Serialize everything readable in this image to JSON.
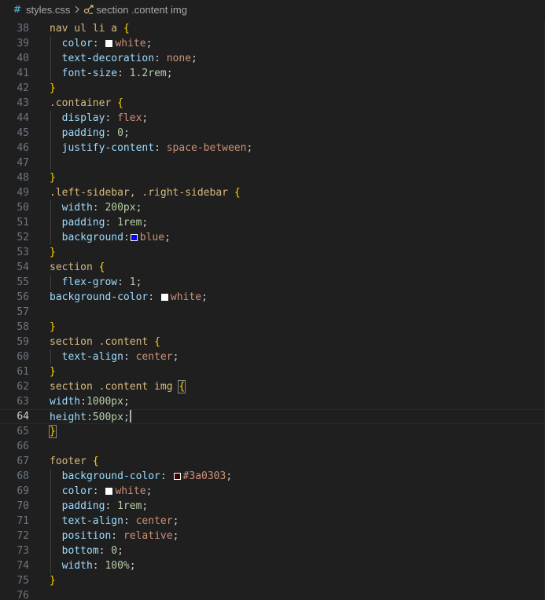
{
  "breadcrumb": {
    "file": "styles.css",
    "symbol": "section .content img"
  },
  "editor": {
    "lines": [
      {
        "n": "38",
        "tokens": [
          [
            "t-sel",
            "nav ul li a "
          ],
          [
            "t-brace",
            "{"
          ]
        ]
      },
      {
        "n": "39",
        "guide": true,
        "tokens": [
          [
            "t-punc",
            "  "
          ],
          [
            "t-prop",
            "color"
          ],
          [
            "t-punc",
            ": "
          ],
          [
            "swatch",
            "#ffffff"
          ],
          [
            "t-val",
            "white"
          ],
          [
            "t-punc",
            ";"
          ]
        ]
      },
      {
        "n": "40",
        "guide": true,
        "tokens": [
          [
            "t-punc",
            "  "
          ],
          [
            "t-prop",
            "text-decoration"
          ],
          [
            "t-punc",
            ": "
          ],
          [
            "t-val",
            "none"
          ],
          [
            "t-punc",
            ";"
          ]
        ]
      },
      {
        "n": "41",
        "guide": true,
        "tokens": [
          [
            "t-punc",
            "  "
          ],
          [
            "t-prop",
            "font-size"
          ],
          [
            "t-punc",
            ": "
          ],
          [
            "t-num",
            "1.2rem"
          ],
          [
            "t-punc",
            ";"
          ]
        ]
      },
      {
        "n": "42",
        "tokens": [
          [
            "t-brace",
            "}"
          ]
        ]
      },
      {
        "n": "43",
        "tokens": [
          [
            "t-sel",
            ".container "
          ],
          [
            "t-brace",
            "{"
          ]
        ]
      },
      {
        "n": "44",
        "guide": true,
        "tokens": [
          [
            "t-punc",
            "  "
          ],
          [
            "t-prop",
            "display"
          ],
          [
            "t-punc",
            ": "
          ],
          [
            "t-val",
            "flex"
          ],
          [
            "t-punc",
            ";"
          ]
        ]
      },
      {
        "n": "45",
        "guide": true,
        "tokens": [
          [
            "t-punc",
            "  "
          ],
          [
            "t-prop",
            "padding"
          ],
          [
            "t-punc",
            ": "
          ],
          [
            "t-num",
            "0"
          ],
          [
            "t-punc",
            ";"
          ]
        ]
      },
      {
        "n": "46",
        "guide": true,
        "tokens": [
          [
            "t-punc",
            "  "
          ],
          [
            "t-prop",
            "justify-content"
          ],
          [
            "t-punc",
            ": "
          ],
          [
            "t-val",
            "space-between"
          ],
          [
            "t-punc",
            ";"
          ]
        ]
      },
      {
        "n": "47",
        "guide": true,
        "tokens": []
      },
      {
        "n": "48",
        "tokens": [
          [
            "t-brace",
            "}"
          ]
        ]
      },
      {
        "n": "49",
        "tokens": [
          [
            "t-sel",
            ".left-sidebar, .right-sidebar "
          ],
          [
            "t-brace",
            "{"
          ]
        ]
      },
      {
        "n": "50",
        "guide": true,
        "tokens": [
          [
            "t-punc",
            "  "
          ],
          [
            "t-prop",
            "width"
          ],
          [
            "t-punc",
            ": "
          ],
          [
            "t-num",
            "200px"
          ],
          [
            "t-punc",
            ";"
          ]
        ]
      },
      {
        "n": "51",
        "guide": true,
        "tokens": [
          [
            "t-punc",
            "  "
          ],
          [
            "t-prop",
            "padding"
          ],
          [
            "t-punc",
            ": "
          ],
          [
            "t-num",
            "1rem"
          ],
          [
            "t-punc",
            ";"
          ]
        ]
      },
      {
        "n": "52",
        "guide": true,
        "tokens": [
          [
            "t-punc",
            "  "
          ],
          [
            "t-prop",
            "background"
          ],
          [
            "t-punc",
            ":"
          ],
          [
            "swatch",
            "#0000ff"
          ],
          [
            "t-val",
            "blue"
          ],
          [
            "t-punc",
            ";"
          ]
        ]
      },
      {
        "n": "53",
        "tokens": [
          [
            "t-brace",
            "}"
          ]
        ]
      },
      {
        "n": "54",
        "tokens": [
          [
            "t-sel",
            "section "
          ],
          [
            "t-brace",
            "{"
          ]
        ]
      },
      {
        "n": "55",
        "guide": true,
        "tokens": [
          [
            "t-punc",
            "  "
          ],
          [
            "t-prop",
            "flex-grow"
          ],
          [
            "t-punc",
            ": "
          ],
          [
            "t-num",
            "1"
          ],
          [
            "t-punc",
            ";"
          ]
        ]
      },
      {
        "n": "56",
        "tokens": [
          [
            "t-prop",
            "background-color"
          ],
          [
            "t-punc",
            ": "
          ],
          [
            "swatch",
            "#ffffff"
          ],
          [
            "t-val",
            "white"
          ],
          [
            "t-punc",
            ";"
          ]
        ]
      },
      {
        "n": "57",
        "tokens": []
      },
      {
        "n": "58",
        "tokens": [
          [
            "t-brace",
            "}"
          ]
        ]
      },
      {
        "n": "59",
        "tokens": [
          [
            "t-sel",
            "section .content "
          ],
          [
            "t-brace",
            "{"
          ]
        ]
      },
      {
        "n": "60",
        "guide": true,
        "tokens": [
          [
            "t-punc",
            "  "
          ],
          [
            "t-prop",
            "text-align"
          ],
          [
            "t-punc",
            ": "
          ],
          [
            "t-val",
            "center"
          ],
          [
            "t-punc",
            ";"
          ]
        ]
      },
      {
        "n": "61",
        "tokens": [
          [
            "t-brace",
            "}"
          ]
        ]
      },
      {
        "n": "62",
        "tokens": [
          [
            "t-sel",
            "section .content img "
          ],
          [
            "t-brace-match",
            "{"
          ]
        ]
      },
      {
        "n": "63",
        "tokens": [
          [
            "t-prop",
            "width"
          ],
          [
            "t-punc",
            ":"
          ],
          [
            "t-num",
            "1000px"
          ],
          [
            "t-punc",
            ";"
          ]
        ]
      },
      {
        "n": "64",
        "current": true,
        "cursor": true,
        "tokens": [
          [
            "t-prop",
            "height"
          ],
          [
            "t-punc",
            ":"
          ],
          [
            "t-num",
            "500px"
          ],
          [
            "t-punc",
            ";"
          ]
        ]
      },
      {
        "n": "65",
        "tokens": [
          [
            "t-brace-match",
            "}"
          ]
        ]
      },
      {
        "n": "66",
        "tokens": []
      },
      {
        "n": "67",
        "tokens": [
          [
            "t-sel",
            "footer "
          ],
          [
            "t-brace",
            "{"
          ]
        ]
      },
      {
        "n": "68",
        "guide": true,
        "tokens": [
          [
            "t-punc",
            "  "
          ],
          [
            "t-prop",
            "background-color"
          ],
          [
            "t-punc",
            ": "
          ],
          [
            "swatch",
            "#3a0303"
          ],
          [
            "t-val",
            "#3a0303"
          ],
          [
            "t-punc",
            ";"
          ]
        ]
      },
      {
        "n": "69",
        "guide": true,
        "tokens": [
          [
            "t-punc",
            "  "
          ],
          [
            "t-prop",
            "color"
          ],
          [
            "t-punc",
            ": "
          ],
          [
            "swatch",
            "#ffffff"
          ],
          [
            "t-val",
            "white"
          ],
          [
            "t-punc",
            ";"
          ]
        ]
      },
      {
        "n": "70",
        "guide": true,
        "tokens": [
          [
            "t-punc",
            "  "
          ],
          [
            "t-prop",
            "padding"
          ],
          [
            "t-punc",
            ": "
          ],
          [
            "t-num",
            "1rem"
          ],
          [
            "t-punc",
            ";"
          ]
        ]
      },
      {
        "n": "71",
        "guide": true,
        "tokens": [
          [
            "t-punc",
            "  "
          ],
          [
            "t-prop",
            "text-align"
          ],
          [
            "t-punc",
            ": "
          ],
          [
            "t-val",
            "center"
          ],
          [
            "t-punc",
            ";"
          ]
        ]
      },
      {
        "n": "72",
        "guide": true,
        "tokens": [
          [
            "t-punc",
            "  "
          ],
          [
            "t-prop",
            "position"
          ],
          [
            "t-punc",
            ": "
          ],
          [
            "t-val",
            "relative"
          ],
          [
            "t-punc",
            ";"
          ]
        ]
      },
      {
        "n": "73",
        "guide": true,
        "tokens": [
          [
            "t-punc",
            "  "
          ],
          [
            "t-prop",
            "bottom"
          ],
          [
            "t-punc",
            ": "
          ],
          [
            "t-num",
            "0"
          ],
          [
            "t-punc",
            ";"
          ]
        ]
      },
      {
        "n": "74",
        "guide": true,
        "tokens": [
          [
            "t-punc",
            "  "
          ],
          [
            "t-prop",
            "width"
          ],
          [
            "t-punc",
            ": "
          ],
          [
            "t-num",
            "100%"
          ],
          [
            "t-punc",
            ";"
          ]
        ]
      },
      {
        "n": "75",
        "tokens": [
          [
            "t-brace",
            "}"
          ]
        ]
      },
      {
        "n": "76",
        "tokens": []
      }
    ]
  }
}
